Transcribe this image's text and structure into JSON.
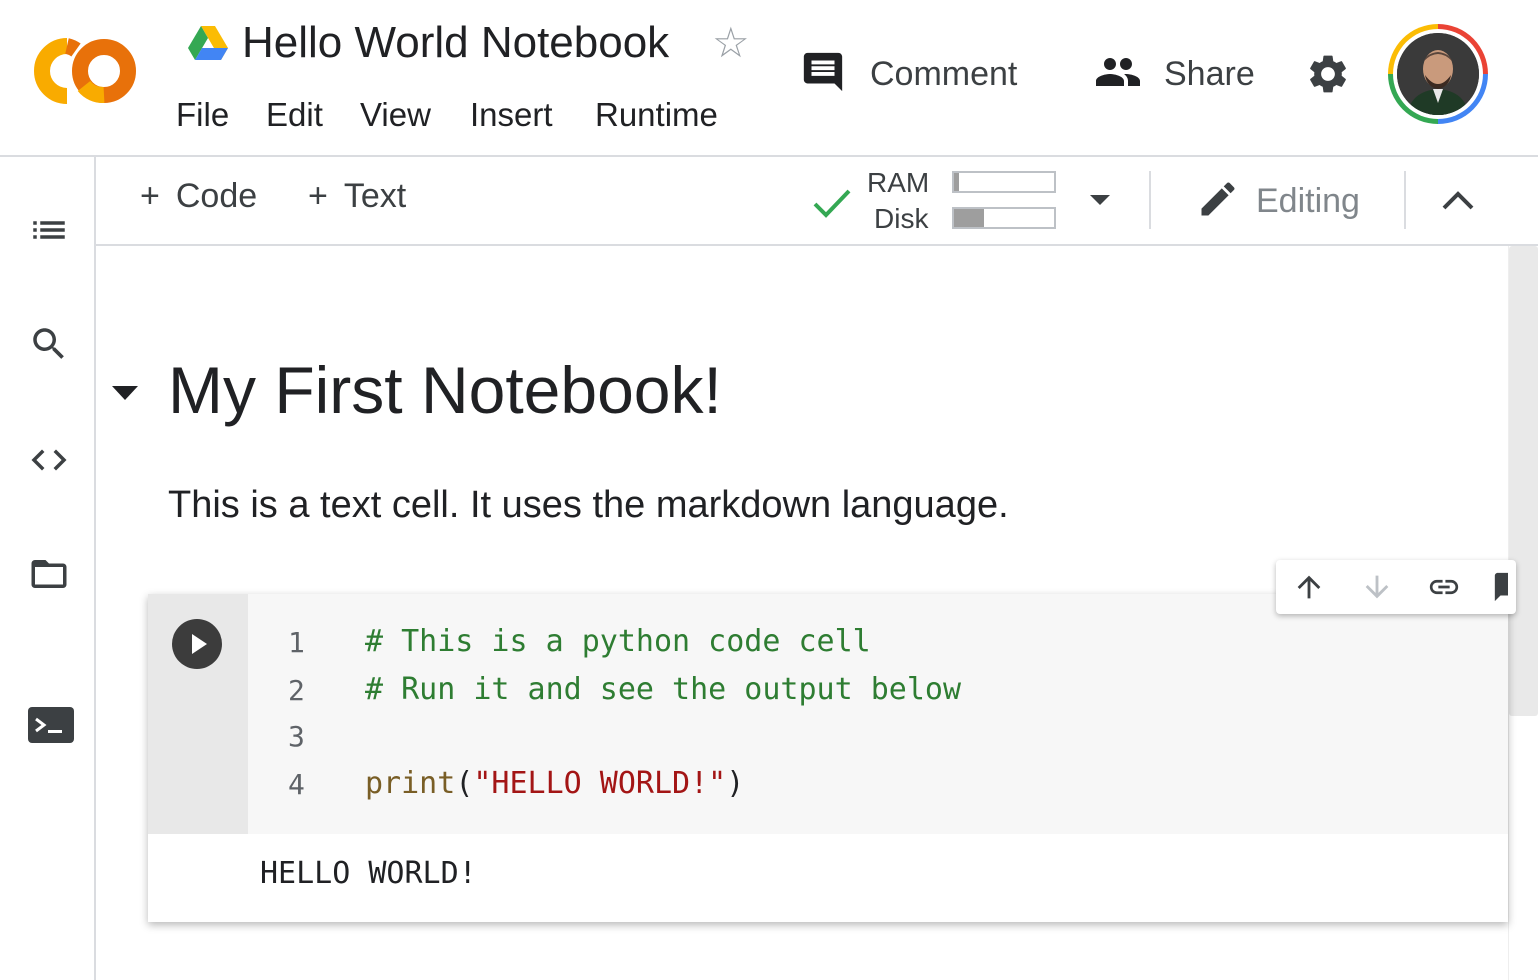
{
  "header": {
    "notebook_title": "Hello World Notebook",
    "logo_text": "CO",
    "menu": [
      "File",
      "Edit",
      "View",
      "Insert",
      "Runtime"
    ],
    "comment_label": "Comment",
    "share_label": "Share"
  },
  "toolbar": {
    "add_code_label": "Code",
    "add_text_label": "Text",
    "ram_label": "RAM",
    "disk_label": "Disk",
    "ram_usage_fraction": 0.05,
    "disk_usage_fraction": 0.3,
    "editing_label": "Editing"
  },
  "notebook": {
    "heading": "My First Notebook!",
    "text_cell": "This is a text cell. It uses the markdown language.",
    "code_cell": {
      "line_numbers": [
        "1",
        "2",
        "3",
        "4"
      ],
      "line1": "# This is a python code cell",
      "line2": "# Run it and see the output below",
      "line4_fn": "print",
      "line4_open": "(",
      "line4_str": "\"HELLO WORLD!\"",
      "line4_close": ")",
      "output": "HELLO WORLD!"
    }
  },
  "colors": {
    "logo_orange": "#f9ab00",
    "logo_dark_orange": "#e8710a",
    "check_green": "#34a853",
    "comment_green": "#2e7d32",
    "string_red": "#a31515",
    "function_brown": "#795e26"
  }
}
